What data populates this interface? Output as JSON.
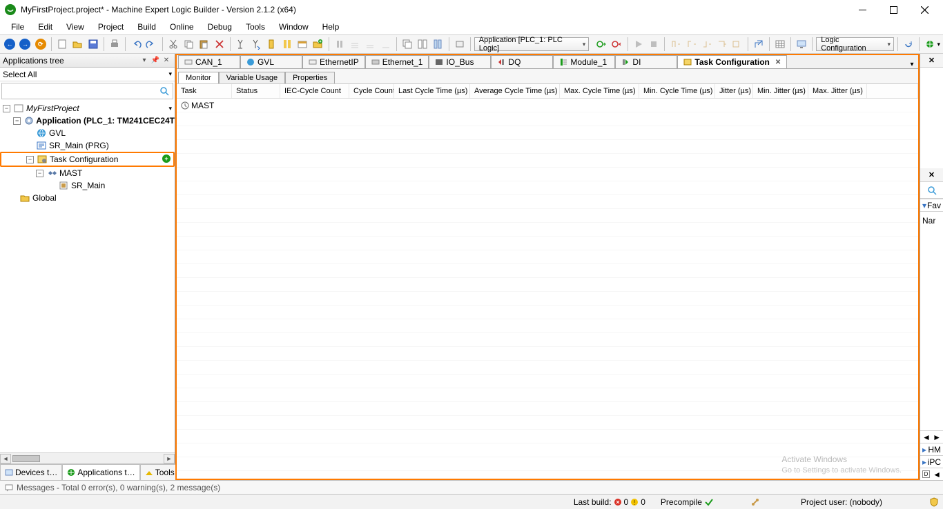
{
  "title": "MyFirstProject.project* - Machine Expert Logic Builder - Version 2.1.2 (x64)",
  "menu": [
    "File",
    "Edit",
    "View",
    "Project",
    "Build",
    "Online",
    "Debug",
    "Tools",
    "Window",
    "Help"
  ],
  "toolbar": {
    "context": "Application [PLC_1: PLC Logic]",
    "combo": "Logic Configuration"
  },
  "leftPanel": {
    "title": "Applications tree",
    "selector": "Select All",
    "tree": {
      "root": "MyFirstProject",
      "app": "Application (PLC_1: TM241CEC24T",
      "gvl": "GVL",
      "sr_main_prg": "SR_Main (PRG)",
      "task_cfg": "Task Configuration",
      "mast": "MAST",
      "sr_main": "SR_Main",
      "global": "Global"
    },
    "tabs": [
      "Devices t…",
      "Applications t…",
      "Tools tree"
    ]
  },
  "docTabs": [
    {
      "icon": "can",
      "label": "CAN_1"
    },
    {
      "icon": "globe",
      "label": "GVL"
    },
    {
      "icon": "eth",
      "label": "EthernetIP"
    },
    {
      "icon": "eth",
      "label": "Ethernet_1"
    },
    {
      "icon": "bus",
      "label": "IO_Bus"
    },
    {
      "icon": "dq",
      "label": "DQ"
    },
    {
      "icon": "mod",
      "label": "Module_1"
    },
    {
      "icon": "di",
      "label": "DI"
    },
    {
      "icon": "task",
      "label": "Task Configuration",
      "active": true,
      "closable": true
    }
  ],
  "subTabs": [
    "Monitor",
    "Variable Usage",
    "Properties"
  ],
  "activeSubTab": 0,
  "grid": {
    "columns": [
      "Task",
      "Status",
      "IEC-Cycle Count",
      "Cycle Count",
      "Last Cycle Time (µs)",
      "Average Cycle Time (µs)",
      "Max. Cycle Time (µs)",
      "Min. Cycle Time (µs)",
      "Jitter (µs)",
      "Min. Jitter (µs)",
      "Max. Jitter (µs)"
    ],
    "rows": [
      {
        "task": "MAST"
      }
    ]
  },
  "rightStrip": {
    "fav": "Fav",
    "nar": "Nar",
    "hm": "HM",
    "ipc": "iPC",
    "d": "D"
  },
  "messages": "Messages - Total 0 error(s), 0 warning(s), 2 message(s)",
  "status": {
    "lastBuild": "Last build:",
    "errors": "0",
    "warnings": "0",
    "precompile": "Precompile",
    "projectUser": "Project user: (nobody)"
  },
  "watermark": {
    "line1": "Activate Windows",
    "line2": "Go to Settings to activate Windows."
  }
}
